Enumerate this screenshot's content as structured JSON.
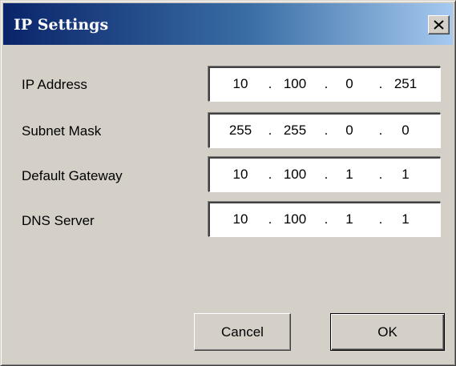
{
  "window": {
    "title": "IP Settings"
  },
  "fields": [
    {
      "label": "IP Address",
      "octets": [
        "10",
        "100",
        "0",
        "251"
      ]
    },
    {
      "label": "Subnet Mask",
      "octets": [
        "255",
        "255",
        "0",
        "0"
      ]
    },
    {
      "label": "Default Gateway",
      "octets": [
        "10",
        "100",
        "1",
        "1"
      ]
    },
    {
      "label": "DNS Server",
      "octets": [
        "10",
        "100",
        "1",
        "1"
      ]
    }
  ],
  "separator": ".",
  "buttons": {
    "cancel_label": "Cancel",
    "ok_label": "OK"
  },
  "icons": {
    "close": "close-icon"
  },
  "colors": {
    "titlebar_start": "#0a246a",
    "titlebar_end": "#a6caf0",
    "dialog_face": "#d4d0c8"
  }
}
